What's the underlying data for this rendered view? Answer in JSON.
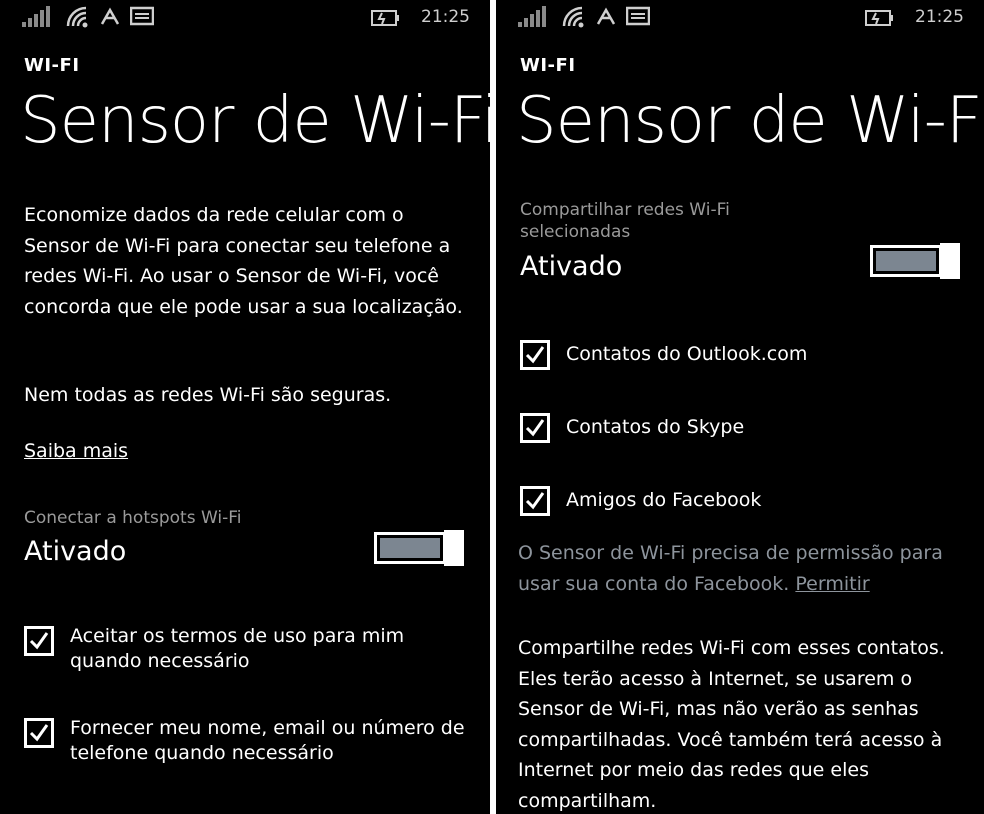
{
  "status": {
    "time": "21:25"
  },
  "left": {
    "app_title": "WI-FI",
    "page_title": "Sensor de Wi-Fi",
    "description": "Economize dados da rede celular com o Sensor de Wi-Fi para conectar seu telefone a redes Wi-Fi. Ao usar o Sensor de Wi-Fi, você concorda que ele pode usar a sua localização.",
    "warning": "Nem todas as redes Wi-Fi são seguras.",
    "learn_more": "Saiba mais",
    "toggle_label": "Conectar a hotspots Wi-Fi",
    "toggle_state": "Ativado",
    "toggle_on": true,
    "checkboxes": [
      {
        "label": "Aceitar os termos de uso para mim quando necessário",
        "checked": true
      },
      {
        "label": "Fornecer meu nome, email ou número de telefone quando necessário",
        "checked": true
      }
    ]
  },
  "right": {
    "app_title": "WI-FI",
    "page_title": "Sensor de Wi-Fi",
    "toggle_label": "Compartilhar redes Wi-Fi selecionadas",
    "toggle_state": "Ativado",
    "toggle_on": true,
    "checkboxes": [
      {
        "label": "Contatos do Outlook.com",
        "checked": true
      },
      {
        "label": "Contatos do Skype",
        "checked": true
      },
      {
        "label": "Amigos do Facebook",
        "checked": true
      }
    ],
    "facebook_notice": "O Sensor de Wi-Fi precisa de permissão para usar sua conta do Facebook.",
    "facebook_permit": "Permitir",
    "share_info": "Compartilhe redes Wi-Fi com esses contatos. Eles terão acesso à Internet, se usarem o Sensor de Wi-Fi, mas não verão as senhas compartilhadas. Você também terá acesso à Internet por meio das redes que eles compartilham."
  },
  "colors": {
    "background": "#000000",
    "text": "#ffffff",
    "secondary": "#9a9a9a",
    "toggle_fill": "#7c8691"
  },
  "icons": [
    "signal-strength-icon",
    "wifi-icon",
    "data-sense-icon",
    "message-icon",
    "battery-charging-icon"
  ]
}
